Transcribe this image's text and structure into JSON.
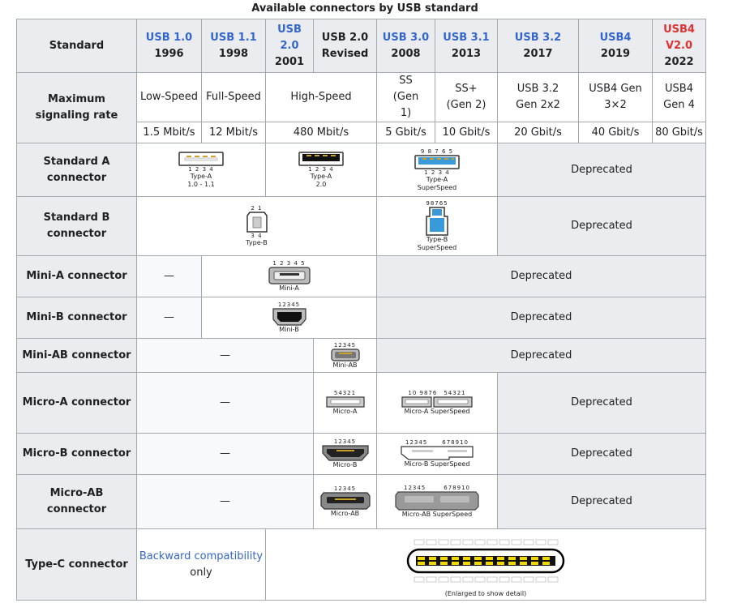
{
  "caption": "Available connectors by USB standard",
  "header": {
    "standard": "Standard",
    "versions": [
      {
        "name": "USB 1.0",
        "year": "1996",
        "style": "link"
      },
      {
        "name": "USB 1.1",
        "year": "1998",
        "style": "link"
      },
      {
        "name": "USB 2.0",
        "year": "2001",
        "style": "link"
      },
      {
        "name": "USB 2.0 Revised",
        "year": "",
        "style": "plain"
      },
      {
        "name": "USB 3.0",
        "year": "2008",
        "style": "link"
      },
      {
        "name": "USB 3.1",
        "year": "2013",
        "style": "link"
      },
      {
        "name": "USB 3.2",
        "year": "2017",
        "style": "link"
      },
      {
        "name": "USB4",
        "year": "2019",
        "style": "link"
      },
      {
        "name": "USB4 V2.0",
        "year": "2022",
        "style": "red"
      }
    ]
  },
  "signaling": {
    "label": "Maximum signaling rate",
    "modes": [
      "Low-Speed",
      "Full-Speed",
      "High-Speed",
      "SS (Gen 1)",
      "SS+ (Gen 2)",
      "USB 3.2 Gen 2x2",
      "USB4 Gen 3×2",
      "USB4 Gen 4"
    ],
    "rates": [
      "1.5 Mbit/s",
      "12 Mbit/s",
      "480 Mbit/s",
      "5 Gbit/s",
      "10 Gbit/s",
      "20 Gbit/s",
      "40 Gbit/s",
      "80 Gbit/s"
    ]
  },
  "rows": {
    "std_a": {
      "label": "Standard A connector",
      "a1_pins": "1 2 3 4",
      "a1_cap": "Type-A",
      "a1_sub": "1.0 - 1.1",
      "a2_pins": "1 2 3 4",
      "a2_cap": "Type-A",
      "a2_sub": "2.0",
      "ss_top": "9 8 7 6 5",
      "ss_pins": "1 2 3 4",
      "ss_cap": "Type-A",
      "ss_sub": "SuperSpeed",
      "deprecated": "Deprecated"
    },
    "std_b": {
      "label": "Standard B connector",
      "b_top": "2 1",
      "b_bot": "3 4",
      "b_cap": "Type-B",
      "ss_top": "98765",
      "ss_cap": "Type-B",
      "ss_sub": "SuperSpeed",
      "deprecated": "Deprecated"
    },
    "mini_a": {
      "label": "Mini-A connector",
      "dash": "—",
      "pins": "1 2 3 4 5",
      "cap": "Mini-A",
      "deprecated": "Deprecated"
    },
    "mini_b": {
      "label": "Mini-B connector",
      "dash": "—",
      "pins": "12345",
      "cap": "Mini-B",
      "deprecated": "Deprecated"
    },
    "mini_ab": {
      "label": "Mini-AB connector",
      "dash": "—",
      "pins": "12345",
      "cap": "Mini-AB",
      "deprecated": "Deprecated"
    },
    "micro_a": {
      "label": "Micro-A connector",
      "dash": "—",
      "pins": "54321",
      "cap": "Micro-A",
      "ss_left": "10 9876",
      "ss_right": "54321",
      "ss_cap": "Micro-A SuperSpeed",
      "deprecated": "Deprecated"
    },
    "micro_b": {
      "label": "Micro-B connector",
      "dash": "—",
      "pins": "12345",
      "cap": "Micro-B",
      "ss_left": "12345",
      "ss_right": "678910",
      "ss_cap": "Micro-B SuperSpeed",
      "deprecated": "Deprecated"
    },
    "micro_ab": {
      "label": "Micro-AB connector",
      "dash": "—",
      "pins": "12345",
      "cap": "Micro-AB",
      "ss_left": "12345",
      "ss_right": "678910",
      "ss_cap": "Micro-AB SuperSpeed",
      "deprecated": "Deprecated"
    },
    "type_c": {
      "label": "Type-C connector",
      "compat_link": "Backward compatibility",
      "compat_rest": "only",
      "cap": "(Enlarged to show detail)"
    }
  }
}
